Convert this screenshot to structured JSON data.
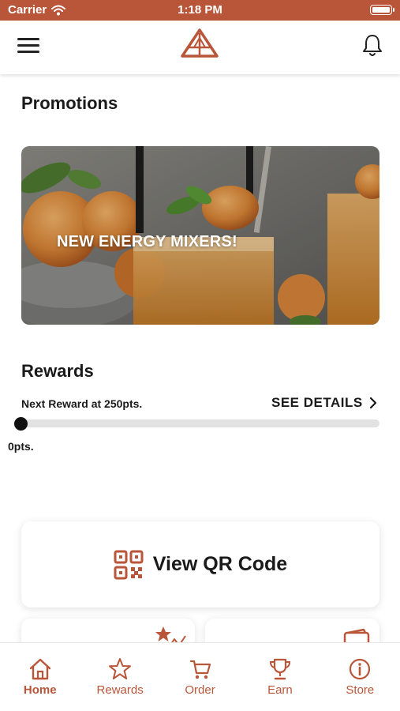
{
  "status_bar": {
    "carrier": "Carrier",
    "time": "1:18 PM"
  },
  "colors": {
    "brand": "#b9563a",
    "text": "#1a1a1a",
    "track": "#e2e2e2"
  },
  "nav": {
    "menu_icon": "hamburger-icon",
    "logo_icon": "triangle-logo",
    "bell_icon": "bell-icon"
  },
  "promotions": {
    "title": "Promotions",
    "card_text": "NEW ENERGY MIXERS!"
  },
  "rewards": {
    "title": "Rewards",
    "next_reward": "Next Reward at 250pts.",
    "see_details": "SEE DETAILS",
    "points": "0pts.",
    "progress": 0
  },
  "qr": {
    "label": "View QR Code",
    "icon": "qr-code-icon"
  },
  "tabs": [
    {
      "label": "Home",
      "icon": "home-icon",
      "active": true
    },
    {
      "label": "Rewards",
      "icon": "star-icon",
      "active": false
    },
    {
      "label": "Order",
      "icon": "cart-icon",
      "active": false
    },
    {
      "label": "Earn",
      "icon": "trophy-icon",
      "active": false
    },
    {
      "label": "Store",
      "icon": "info-icon",
      "active": false
    }
  ]
}
